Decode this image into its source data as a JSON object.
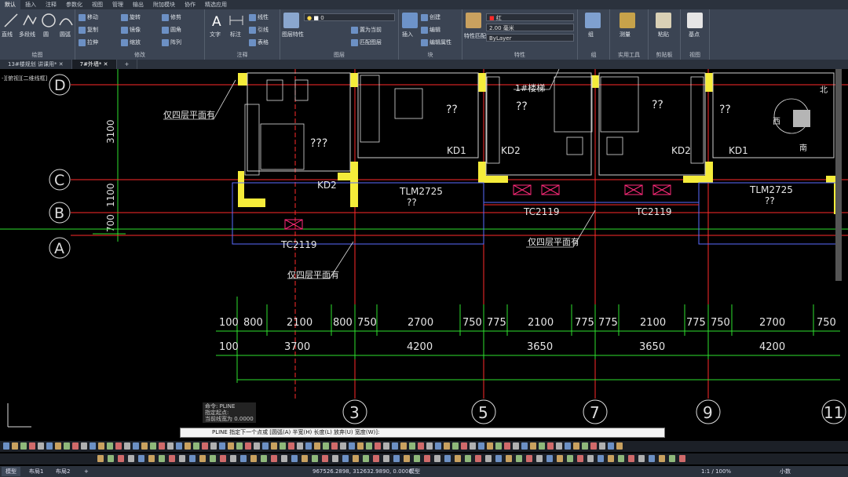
{
  "ribbon": {
    "tabs": [
      "默认",
      "插入",
      "注释",
      "参数化",
      "视图",
      "管理",
      "输出",
      "附加模块",
      "协作",
      "精选应用"
    ],
    "panels": {
      "draw": {
        "title": "绘图",
        "buttons": [
          "直线",
          "多段线",
          "圆",
          "圆弧"
        ]
      },
      "modify": {
        "title": "修改",
        "buttons": [
          "移动",
          "旋转",
          "修剪",
          "复制",
          "镜像",
          "圆角",
          "拉伸",
          "缩放",
          "阵列"
        ]
      },
      "annotation": {
        "title": "注释",
        "buttons": [
          "文字",
          "标注",
          "线性",
          "引线",
          "表格"
        ]
      },
      "layers": {
        "title": "图层",
        "buttons": [
          "图层特性",
          "置为当前",
          "匹配图层"
        ],
        "current_layer": "0"
      },
      "block": {
        "title": "块",
        "buttons": [
          "插入",
          "创建",
          "编辑",
          "编辑属性"
        ]
      },
      "properties": {
        "title": "特性",
        "buttons": [
          "特性匹配"
        ],
        "color": "红",
        "lineweight": "2.00 毫米",
        "linetype": "ByLayer"
      },
      "groups": {
        "title": "组",
        "buttons": [
          "组"
        ]
      },
      "utilities": {
        "title": "实用工具",
        "buttons": [
          "测量"
        ]
      },
      "clipboard": {
        "title": "剪贴板",
        "buttons": [
          "粘贴"
        ]
      },
      "view": {
        "title": "视图",
        "buttons": [
          "基点"
        ]
      }
    }
  },
  "doc_tabs": [
    "13#楼规划 讲课用*",
    "7#外墙*"
  ],
  "viewport_label": "-][俯视][二维线框]",
  "drawing": {
    "grid_letters": [
      "D",
      "C",
      "B",
      "A"
    ],
    "grid_numbers": [
      "3",
      "5",
      "7",
      "9",
      "11"
    ],
    "vertical_dims": [
      "3100",
      "1100",
      "700"
    ],
    "dim_row1": [
      "100",
      "800",
      "2100",
      "800",
      "750",
      "2700",
      "750",
      "775",
      "2100",
      "775",
      "775",
      "2100",
      "775",
      "750",
      "2700",
      "750"
    ],
    "dim_row2": [
      "100",
      "3700",
      "4200",
      "3650",
      "3650",
      "4200"
    ],
    "labels": {
      "only_4th_1": "仅四层平面有",
      "only_4th_2": "仅四层平面有",
      "only_4th_3": "仅四层平面有",
      "stair": "1#楼梯",
      "kd1_a": "KD1",
      "kd1_b": "KD1",
      "kd2_a": "KD2",
      "kd2_b": "KD2",
      "kd2_c": "KD2",
      "tlm_a": "TLM2725",
      "tlm_b": "TLM2725",
      "tc_a": "TC2119",
      "tc_b": "TC2119",
      "tc_c": "TC2119",
      "q1": "???",
      "q2": "??",
      "q3": "??",
      "q4": "??",
      "q5": "??",
      "q6": "??",
      "q7": "??",
      "q8": "??",
      "q9": "??",
      "north": "北",
      "south": "南",
      "west": "西"
    }
  },
  "command": {
    "history": [
      "命令: PLINE",
      "指定起点:",
      "当前线宽为 0.0000"
    ],
    "prompt": "PLINE 指定下一个点或 [圆弧(A) 半宽(H) 长度(L) 放弃(U) 宽度(W)]:"
  },
  "status": {
    "layouts": [
      "模型",
      "布局1",
      "布局2"
    ],
    "coords": "967526.2898, 312632.9890, 0.0000",
    "model_label": "模型",
    "scale": "1:1 / 100%",
    "units": "小数"
  },
  "colors": {
    "accent": "#3b4453",
    "wall": "#f5ec3a",
    "grid": "#2ee02e",
    "red": "#ff2a2a",
    "dim": "#2ee02e"
  }
}
